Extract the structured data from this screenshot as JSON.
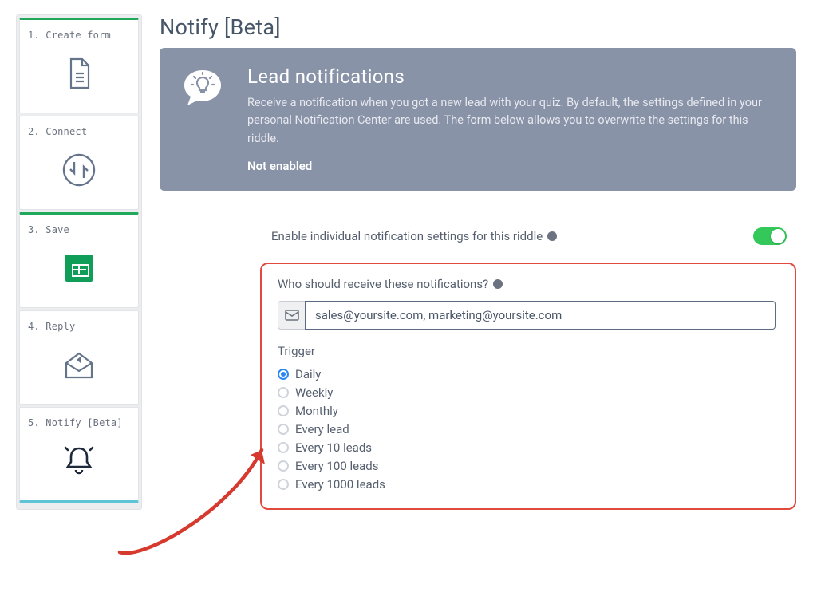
{
  "page": {
    "title": "Notify [Beta]"
  },
  "sidebar": {
    "steps": [
      {
        "label": "1. Create form"
      },
      {
        "label": "2. Connect"
      },
      {
        "label": "3. Save"
      },
      {
        "label": "4. Reply"
      },
      {
        "label": "5. Notify [Beta]"
      }
    ]
  },
  "banner": {
    "title": "Lead notifications",
    "description": "Receive a notification when you got a new lead with your quiz. By default, the settings defined in your personal Notification Center are used. The form below allows you to overwrite the settings for this riddle.",
    "status": "Not enabled"
  },
  "enable": {
    "label": "Enable individual notification settings for this riddle",
    "value": true
  },
  "recipients": {
    "label": "Who should receive these notifications?",
    "value": "sales@yoursite.com, marketing@yoursite.com"
  },
  "trigger": {
    "heading": "Trigger",
    "selected": 0,
    "options": [
      "Daily",
      "Weekly",
      "Monthly",
      "Every lead",
      "Every 10 leads",
      "Every 100 leads",
      "Every 1000 leads"
    ]
  },
  "colors": {
    "accent_green": "#22a85a",
    "highlight_red": "#e04a3f",
    "active_blue": "#5ec4d6"
  }
}
